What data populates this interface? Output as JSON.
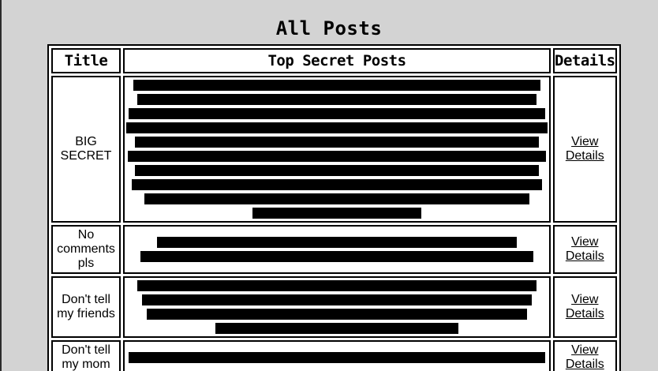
{
  "page": {
    "title": "All Posts"
  },
  "table": {
    "headers": {
      "title": "Title",
      "posts": "Top Secret Posts",
      "details": "Details"
    },
    "rows": [
      {
        "title": "BIG SECRET",
        "redacted_lines": 10,
        "details_label": "View Details"
      },
      {
        "title": "No comments pls",
        "redacted_lines": 2,
        "details_label": "View Details"
      },
      {
        "title": "Don't tell my friends",
        "redacted_lines": 4,
        "details_label": "View Details"
      },
      {
        "title": "Don't tell my mom",
        "redacted_lines": 1,
        "details_label": "View Details"
      }
    ]
  },
  "colors": {
    "background": "#d3d3d3",
    "table_background": "#ffffff",
    "redaction": "#000000"
  }
}
